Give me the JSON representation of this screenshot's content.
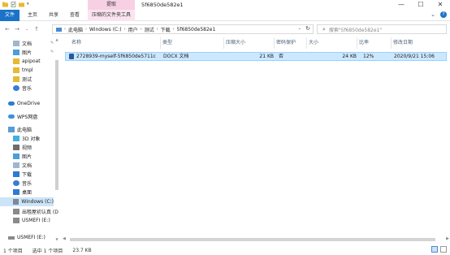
{
  "window": {
    "title": "5f6850de582e1",
    "context_tab_head": "提取",
    "controls": {
      "minimize": "—",
      "maximize": "☐",
      "close": "✕"
    }
  },
  "ribbon": {
    "tabs": [
      {
        "label": "文件"
      },
      {
        "label": "主页"
      },
      {
        "label": "共享"
      },
      {
        "label": "查看"
      },
      {
        "label": "压缩的文件夹工具"
      }
    ],
    "expand_icon": "⌄",
    "help_icon": "?"
  },
  "address": {
    "crumbs": [
      "此电脑",
      "Windows (C:)",
      "用户",
      "测试",
      "下载",
      "5f6850de582e1"
    ],
    "refresh": "↻",
    "dropdown": "⌄"
  },
  "search": {
    "placeholder": "搜索\"5f6850de582e1\""
  },
  "nav": {
    "items": [
      {
        "label": "文档",
        "icon": "documents-icon",
        "pinned": true
      },
      {
        "label": "图片",
        "icon": "pictures-icon",
        "pinned": true
      },
      {
        "label": "apipoat",
        "icon": "folder-icon"
      },
      {
        "label": "tmpl",
        "icon": "folder-icon"
      },
      {
        "label": "测试",
        "icon": "folder-icon"
      },
      {
        "label": "音乐",
        "icon": "music-icon"
      },
      {
        "label": "OneDrive",
        "icon": "onedrive-icon"
      },
      {
        "label": "WPS网盘",
        "icon": "wps-cloud-icon"
      },
      {
        "label": "此电脑",
        "icon": "this-pc-icon"
      },
      {
        "label": "3D 对象",
        "icon": "3d-objects-icon"
      },
      {
        "label": "视频",
        "icon": "videos-icon"
      },
      {
        "label": "图片",
        "icon": "pictures-icon"
      },
      {
        "label": "文档",
        "icon": "documents-icon"
      },
      {
        "label": "下载",
        "icon": "downloads-icon"
      },
      {
        "label": "音乐",
        "icon": "music-icon"
      },
      {
        "label": "桌面",
        "icon": "desktop-icon"
      },
      {
        "label": "Windows (C:)",
        "icon": "drive-c-icon",
        "selected": true
      },
      {
        "label": "出租屋初认真 (D",
        "icon": "drive-icon"
      },
      {
        "label": "USMEFI (E:)",
        "icon": "drive-icon"
      },
      {
        "label": "USMEFI (E:)",
        "icon": "usb-drive-icon"
      }
    ]
  },
  "columns": [
    "名称",
    "类型",
    "压缩大小",
    "密码保护",
    "大小",
    "比率",
    "修改日期"
  ],
  "files": [
    {
      "name": "2728939-myself-5f6850de5711c",
      "type": "DOCX 文档",
      "compressed_size": "21 KB",
      "password": "否",
      "size": "24 KB",
      "ratio": "12%",
      "modified": "2020/9/21 15:06"
    }
  ],
  "status": {
    "count": "1 个项目",
    "selected": "选中 1 个项目",
    "selected_size": "23.7 KB"
  },
  "colors": {
    "file_tab": "#1a73c9",
    "context_tab": "#f7d0e4",
    "selection": "#cce8ff",
    "selection_border": "#99d1ff"
  }
}
